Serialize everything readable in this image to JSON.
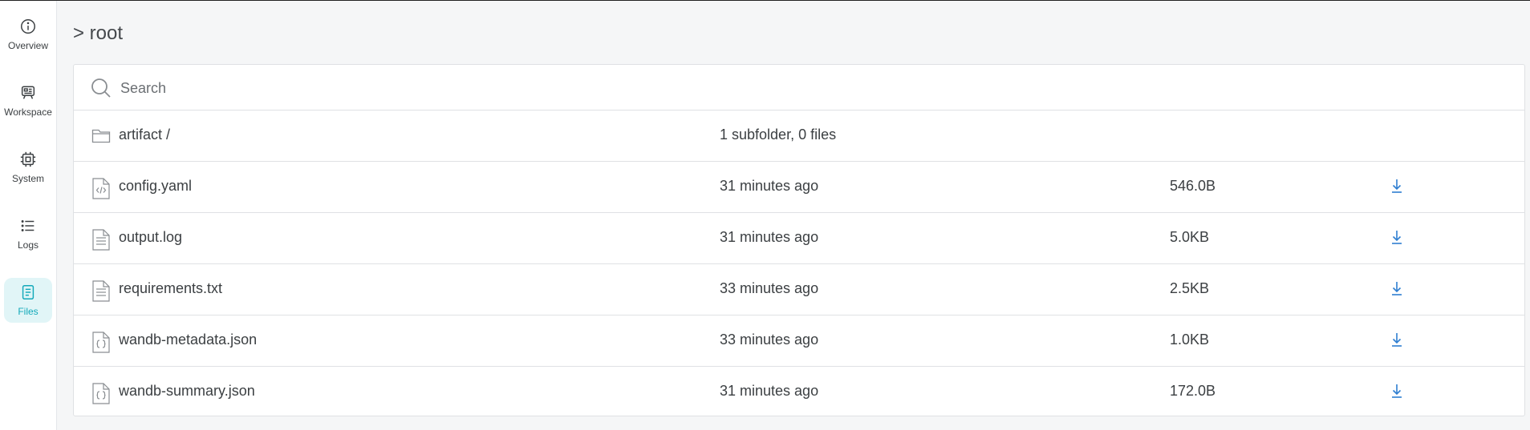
{
  "sidebar": {
    "items": [
      {
        "label": "Overview",
        "icon": "info-circle-icon",
        "active": false
      },
      {
        "label": "Workspace",
        "icon": "workspace-icon",
        "active": false
      },
      {
        "label": "System",
        "icon": "chip-icon",
        "active": false
      },
      {
        "label": "Logs",
        "icon": "list-icon",
        "active": false
      },
      {
        "label": "Files",
        "icon": "file-icon",
        "active": true
      }
    ],
    "accent_color": "#13a9ba",
    "active_bg": "#e1f5f7"
  },
  "breadcrumb": "> root",
  "search": {
    "placeholder": "Search",
    "value": ""
  },
  "files": {
    "folder": {
      "name": "artifact /",
      "meta": "1 subfolder, 0 files",
      "icon": "folder-icon"
    },
    "items": [
      {
        "name": "config.yaml",
        "modified": "31 minutes ago",
        "size": "546.0B",
        "icon": "code-file-icon"
      },
      {
        "name": "output.log",
        "modified": "31 minutes ago",
        "size": "5.0KB",
        "icon": "text-file-icon"
      },
      {
        "name": "requirements.txt",
        "modified": "33 minutes ago",
        "size": "2.5KB",
        "icon": "text-file-icon"
      },
      {
        "name": "wandb-metadata.json",
        "modified": "33 minutes ago",
        "size": "1.0KB",
        "icon": "json-file-icon"
      },
      {
        "name": "wandb-summary.json",
        "modified": "31 minutes ago",
        "size": "172.0B",
        "icon": "json-file-icon"
      }
    ]
  },
  "download_icon": "download-icon",
  "download_color": "#2f7fd1"
}
